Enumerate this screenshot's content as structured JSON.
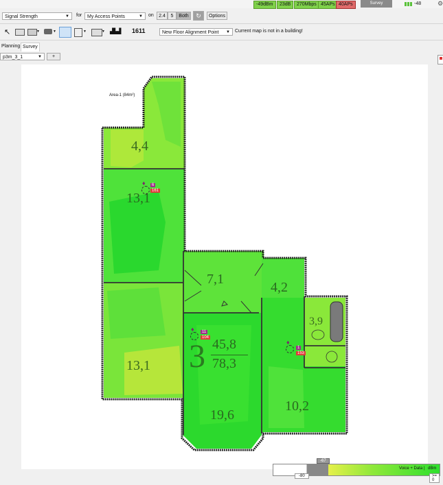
{
  "topbar": {
    "stats": [
      {
        "label": "-49dBm",
        "color": "#7fd14a"
      },
      {
        "label": "23dB",
        "color": "#7fd14a"
      },
      {
        "label": "270Mbps",
        "color": "#7fd14a"
      },
      {
        "label": "45APs",
        "color": "#7fd14a"
      },
      {
        "label": "40APs",
        "color": "#e06a6a"
      }
    ],
    "survey_button": "Survey",
    "signal_value": "-48"
  },
  "toolbar": {
    "visualization": "Signal Strength",
    "for_label": "for",
    "access_points": "My Access Points",
    "on_label": "on",
    "band_24": "2.4",
    "band_5": "5",
    "band_both": "Both",
    "options": "Options",
    "alignment_select": "New Floor Alignment Point",
    "status_message": "Current map is not in a building!",
    "channel_label": "1611"
  },
  "tabs": {
    "planning": "Planning",
    "survey": "Survey"
  },
  "map_select": "p3m_3_1",
  "add_button": "+",
  "floorplan": {
    "area_label": "Area-1 (84m²)",
    "rooms": [
      {
        "name": "room-a",
        "label": "4,4"
      },
      {
        "name": "room-b",
        "label": "13,1"
      },
      {
        "name": "room-c",
        "label": "13,1"
      },
      {
        "name": "room-d",
        "label": "7,1"
      },
      {
        "name": "room-e",
        "label": "4,2"
      },
      {
        "name": "room-f",
        "label": "3,9"
      },
      {
        "name": "room-g",
        "label": "19,6"
      },
      {
        "name": "room-h",
        "label": "10,2"
      }
    ],
    "big_number": "3",
    "fraction_top": "45,8",
    "fraction_bottom": "78,3",
    "access_points": [
      {
        "top": "6",
        "bottom": "161"
      },
      {
        "top": "11",
        "bottom": "104"
      },
      {
        "top": "1",
        "bottom": "153"
      }
    ]
  },
  "legend": {
    "threshold": "-67",
    "min": "-80",
    "max": ">= 0",
    "mode_label": "Voice + Data",
    "unit": "dBm"
  },
  "colors": {
    "green_strong": "#2ee02e",
    "green_mid": "#66ee33",
    "yellow_green": "#bde83a",
    "ap_red": "#e03a3a",
    "ap_purple": "#a0308a"
  }
}
